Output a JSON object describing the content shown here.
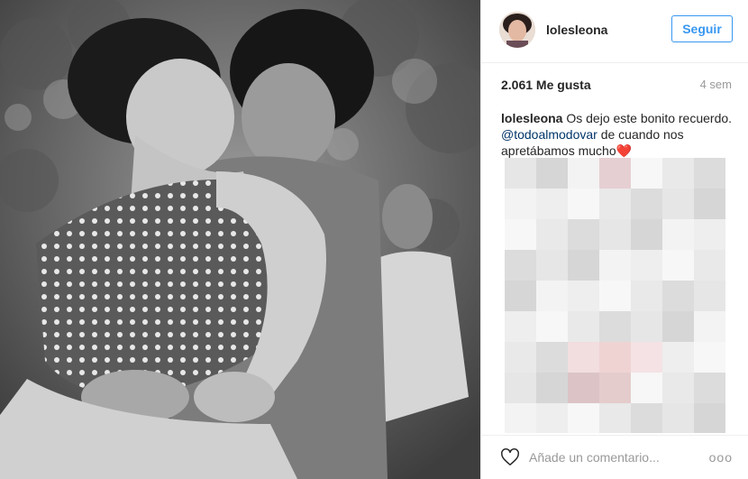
{
  "post": {
    "username": "lolesleona",
    "follow_label": "Seguir",
    "likes": "2.061 Me gusta",
    "age": "4 sem",
    "caption": {
      "username": "lolesleona",
      "text_before": "Os dejo este bonito recuerdo.",
      "mention": "@todoalmodovar",
      "text_after": "de cuando nos apretábamos mucho",
      "emoji": "❤️"
    },
    "comment_placeholder": "Añade un comentario...",
    "more_label": "ooo"
  },
  "colors": {
    "accent": "#3897f0",
    "text": "#262626",
    "muted": "#999999",
    "mention": "#003569",
    "heart": "#ed4956"
  },
  "icons": {
    "like": "heart-outline-icon",
    "more": "ellipsis-icon"
  }
}
